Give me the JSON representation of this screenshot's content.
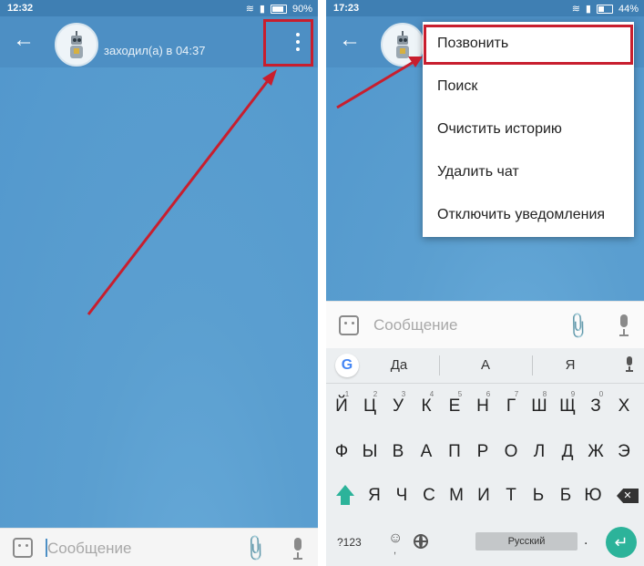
{
  "left": {
    "status_bar": {
      "time": "12:32",
      "battery": "90%"
    },
    "chat_header": {
      "last_seen": "заходил(а) в 04:37"
    },
    "input": {
      "placeholder": "Сообщение"
    }
  },
  "right": {
    "status_bar": {
      "time": "17:23",
      "battery": "44%"
    },
    "menu": {
      "items": [
        "Позвонить",
        "Поиск",
        "Очистить историю",
        "Удалить чат",
        "Отключить уведомления"
      ]
    },
    "input": {
      "placeholder": "Сообщение"
    },
    "keyboard": {
      "suggestions": [
        "Да",
        "А",
        "Я"
      ],
      "row1": [
        "Й",
        "Ц",
        "У",
        "К",
        "Е",
        "Н",
        "Г",
        "Ш",
        "Щ",
        "З",
        "Х"
      ],
      "row1_hints": [
        "1",
        "2",
        "3",
        "4",
        "5",
        "6",
        "7",
        "8",
        "9",
        "0",
        ""
      ],
      "row2": [
        "Ф",
        "Ы",
        "В",
        "А",
        "П",
        "Р",
        "О",
        "Л",
        "Д",
        "Ж",
        "Э"
      ],
      "row3": [
        "Я",
        "Ч",
        "С",
        "М",
        "И",
        "Т",
        "Ь",
        "Б",
        "Ю"
      ],
      "symbols_key": "?123",
      "comma_key": ",",
      "space_label": "Русский",
      "period_key": "."
    }
  },
  "colors": {
    "toolbar": "#4d8fc4",
    "chat_background": "#5b9fd0",
    "highlight": "#c81e2e",
    "keyboard_accent": "#2cb39a"
  }
}
